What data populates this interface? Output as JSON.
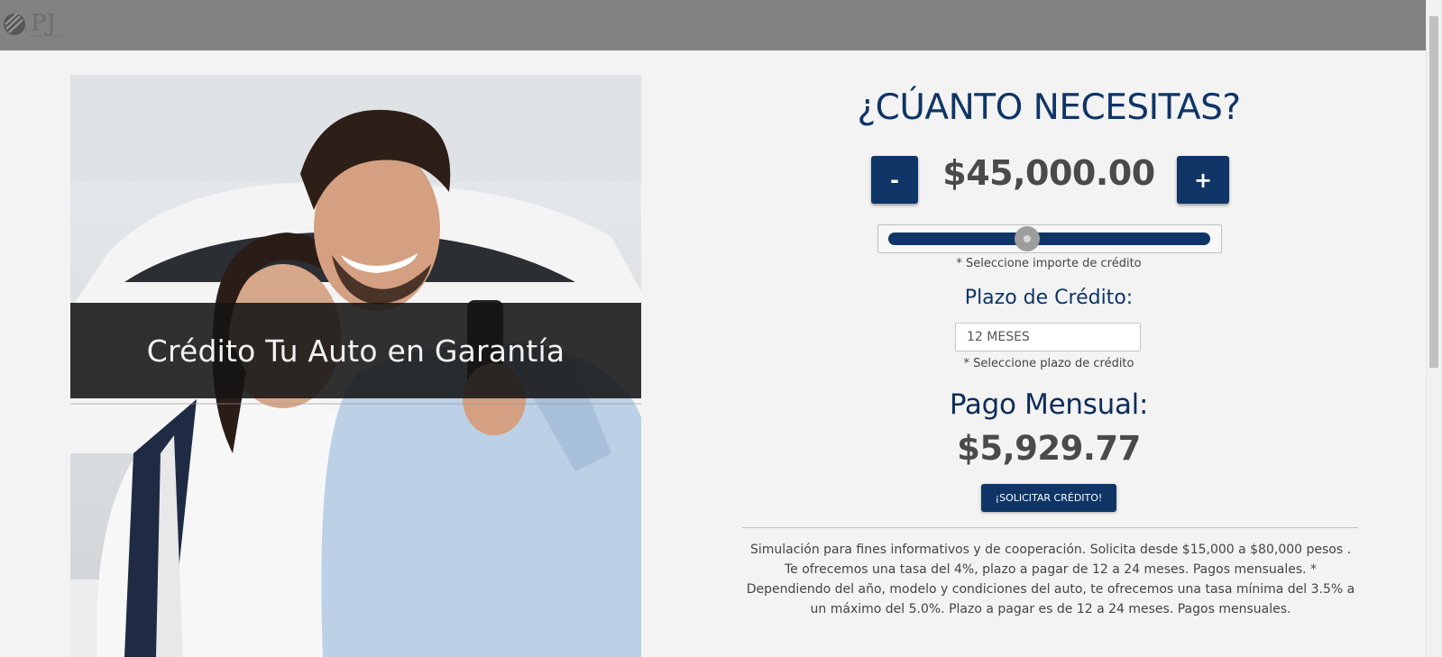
{
  "header": {
    "logo_text": "PJ"
  },
  "hero": {
    "title": "Crédito Tu Auto en Garantía"
  },
  "calculator": {
    "heading": "¿CÚANTO NECESITAS?",
    "minus_label": "-",
    "plus_label": "+",
    "amount": "$45,000.00",
    "slider_position_fraction": 0.43,
    "amount_hint": "* Seleccione importe de crédito",
    "term_label": "Plazo de Crédito:",
    "term_value": "12 MESES",
    "term_hint": "* Seleccione plazo de crédito",
    "monthly_label": "Pago Mensual:",
    "monthly_value": "$5,929.77",
    "apply_label": "¡SOLICITAR CRÉDITO!",
    "disclaimer": "Simulación para fines informativos y de cooperación. Solicita desde $15,000 a $80,000 pesos . Te ofrecemos una tasa del 4%, plazo a pagar de 12 a 24 meses. Pagos mensuales. * Dependiendo del año, modelo y condiciones del auto, te ofrecemos una tasa mínima del 3.5% a un máximo del 5.0%. Plazo a pagar es de 12 a 24 meses. Pagos mensuales."
  },
  "colors": {
    "primary": "#0e3566",
    "topbar": "#828282",
    "background": "#f3f3f3"
  }
}
